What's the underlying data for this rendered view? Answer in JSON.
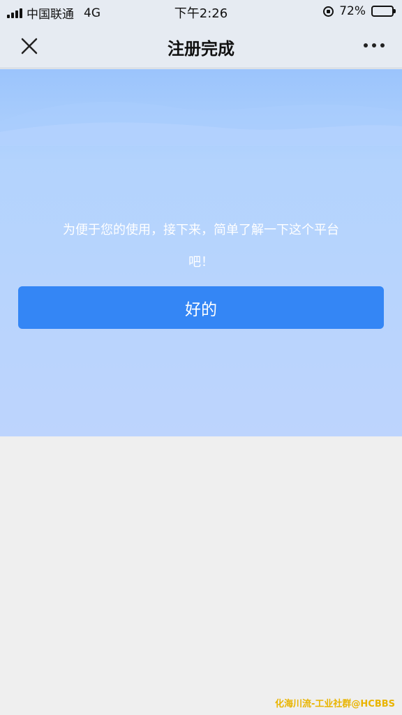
{
  "status_bar": {
    "carrier": "中国联通",
    "network": "4G",
    "time": "下午2:26",
    "battery": "72%",
    "battery_level": 0.72
  },
  "nav": {
    "title": "注册完成",
    "close_icon": "close-icon",
    "more_icon": "more-horizontal-icon"
  },
  "hero": {
    "message": "为便于您的使用，接下来，简单了解一下这个平台吧！",
    "button_label": "好的"
  },
  "watermark": "化海川流-工业社群@HCBBS",
  "colors": {
    "nav_background": "#e6ebf2",
    "hero_background": "#b8d4fd",
    "button": "#3486f5",
    "page_background": "#efefef",
    "watermark": "#e9b400"
  }
}
